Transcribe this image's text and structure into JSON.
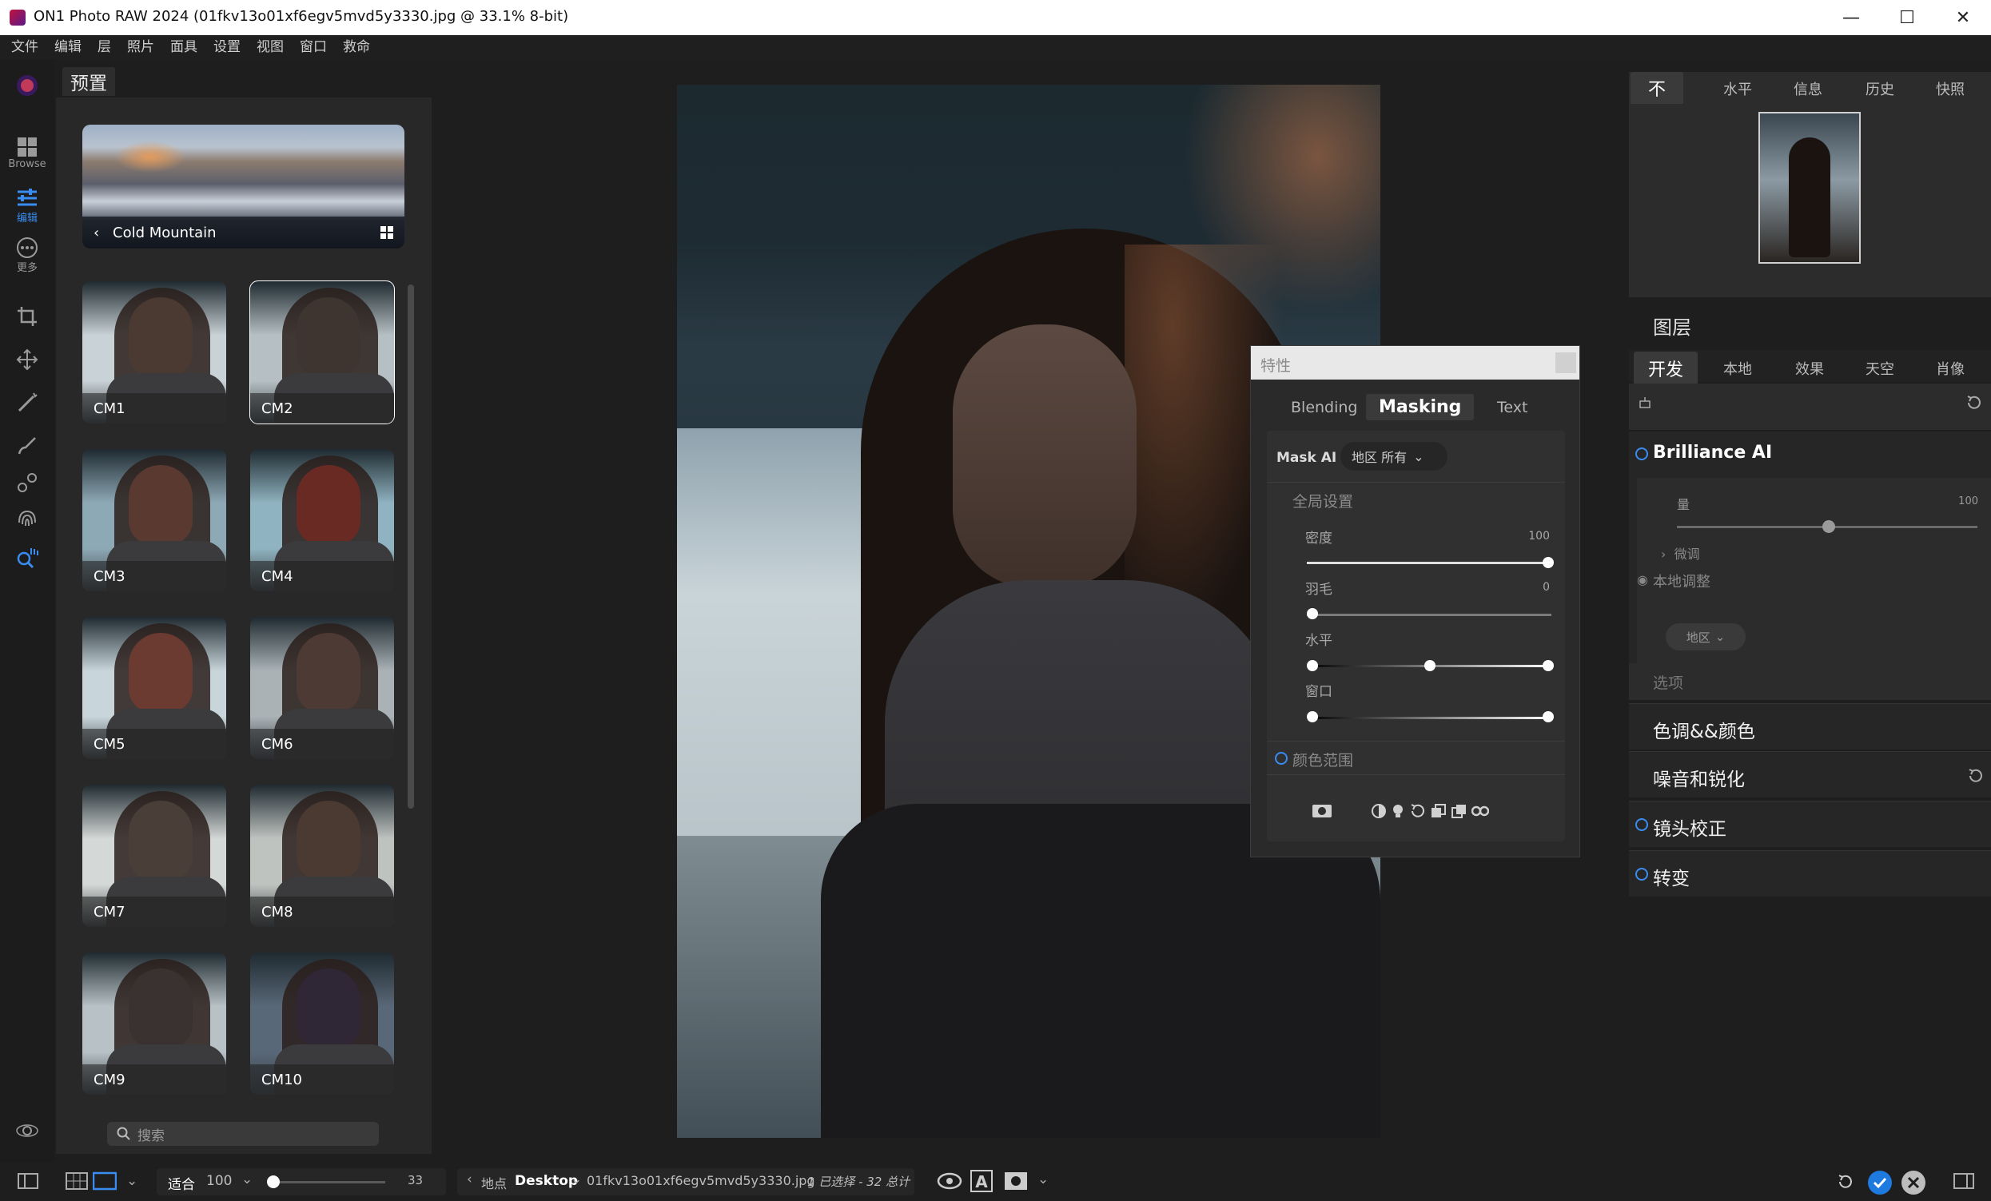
{
  "window": {
    "title": "ON1 Photo RAW 2024 (01fkv13o01xf6egv5mvd5y3330.jpg @ 33.1% 8-bit)",
    "controls": [
      "—",
      "☐",
      "✕"
    ]
  },
  "menu": [
    "文件",
    "编辑",
    "层",
    "照片",
    "面具",
    "设置",
    "视图",
    "窗口",
    "救命"
  ],
  "left_tools": {
    "browse_label": "Browse",
    "edit_label": "编辑",
    "more_label": "更多"
  },
  "presets": {
    "tab_label": "预置",
    "category": "Cold Mountain",
    "items": [
      {
        "label": "CM1"
      },
      {
        "label": "CM2"
      },
      {
        "label": "CM3"
      },
      {
        "label": "CM4"
      },
      {
        "label": "CM5"
      },
      {
        "label": "CM6"
      },
      {
        "label": "CM7"
      },
      {
        "label": "CM8"
      },
      {
        "label": "CM9"
      },
      {
        "label": "CM10"
      }
    ],
    "selected": "CM2",
    "search_placeholder": "搜索"
  },
  "properties": {
    "title": "特性",
    "tabs": [
      "Blending",
      "Masking",
      "Text"
    ],
    "active_tab": "Masking",
    "mask_ai_label": "Mask AI",
    "mask_ai_dropdown": "地区 所有",
    "global_settings": "全局设置",
    "density_label": "密度",
    "density_value": "100",
    "feather_label": "羽毛",
    "feather_value": "0",
    "level_label": "水平",
    "window_label": "窗口",
    "color_range_label": "颜色范围"
  },
  "right_panel": {
    "tabs": [
      "不",
      "水平",
      "信息",
      "历史",
      "快照"
    ],
    "layers_label": "图层",
    "dev_tabs": [
      "开发",
      "本地",
      "效果",
      "天空",
      "肖像"
    ],
    "brilliance": "Brilliance AI",
    "amount_label": "量",
    "amount_value": "100",
    "fine_tune": "微调",
    "local_adjust": "本地调整",
    "region_dropdown": "地区",
    "options_label": "选项",
    "sections": [
      "色调&&颜色",
      "噪音和锐化",
      "镜头校正",
      "转变"
    ]
  },
  "bottom_bar": {
    "fit_label": "适合",
    "zoom_value": "100",
    "slider_value": "33",
    "location_label": "地点",
    "location_value": "Desktop",
    "filename": "01fkv13o01xf6egv5mvd5y3330.jpg",
    "selection_info": "1 已选择 - 32 总计"
  },
  "colors": {
    "accent": "#3a8cf0",
    "panel_bg": "#282828",
    "app_bg": "#1e1e1e"
  }
}
